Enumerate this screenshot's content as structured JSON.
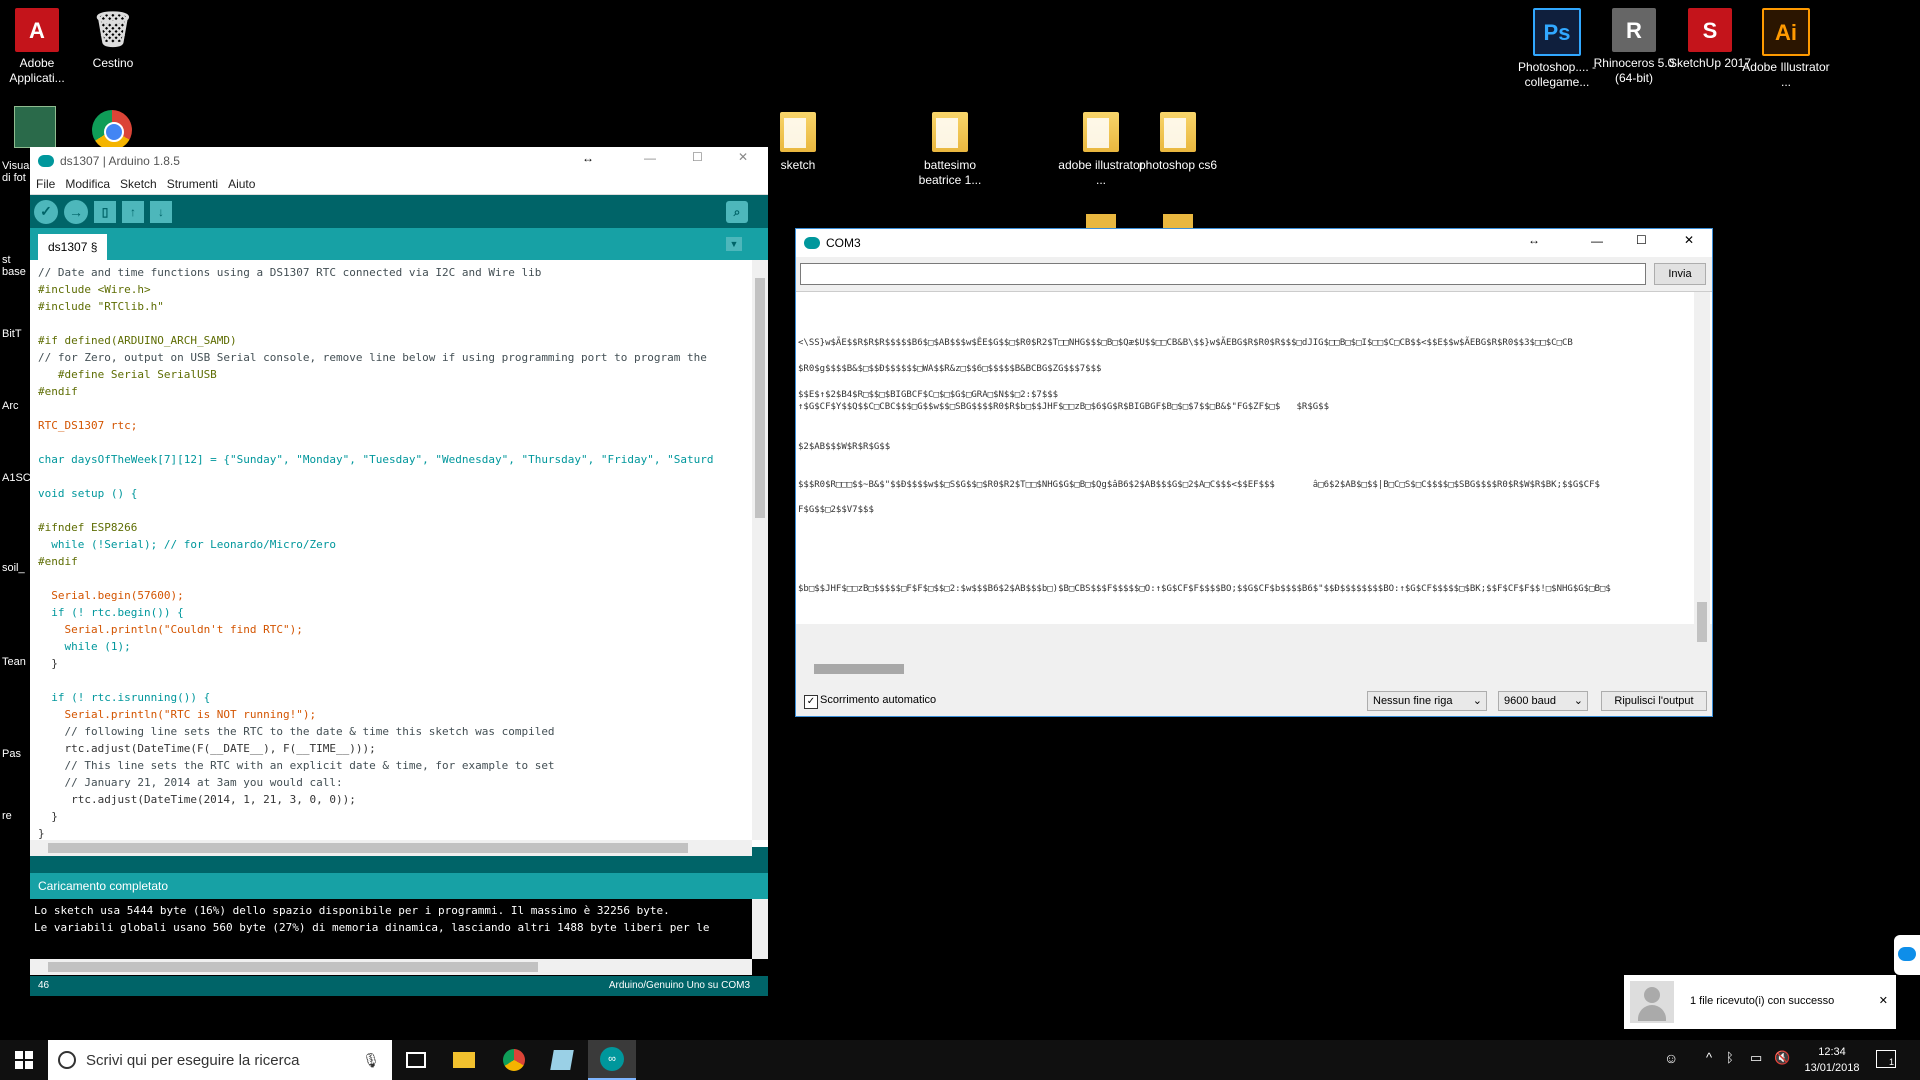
{
  "desktop": {
    "left_icons": [
      {
        "label": "Adobe Applicati...",
        "glyph": "A",
        "bg": "#c4141b"
      },
      {
        "label": "Cestino",
        "glyph": "🗑",
        "bg": "transparent"
      }
    ],
    "right_icons": [
      {
        "label": "Photoshop.... - collegame...",
        "glyph": "Ps",
        "bg": "#0f1f3d",
        "fg": "#31a8ff"
      },
      {
        "label": "Rhinoceros 5.0 (64-bit)",
        "glyph": "R",
        "bg": "#555",
        "fg": "#fff"
      },
      {
        "label": "SketchUp 2017",
        "glyph": "S",
        "bg": "#c4141b",
        "fg": "#fff"
      },
      {
        "label": "Adobe Illustrator ...",
        "glyph": "Ai",
        "bg": "#2b1500",
        "fg": "#ff9a00"
      }
    ],
    "folders": [
      {
        "label": "sketch"
      },
      {
        "label": "battesimo beatrice 1..."
      },
      {
        "label": "adobe illustrator ..."
      },
      {
        "label": "photoshop cs6"
      }
    ],
    "strip_labels": [
      "Visua di fot",
      "st base",
      "BitT",
      "Arc",
      "A1SC",
      "soil_",
      "Tean",
      "Pas",
      "re"
    ]
  },
  "arduino": {
    "title": "ds1307 | Arduino 1.8.5",
    "menu": [
      "File",
      "Modifica",
      "Sketch",
      "Strumenti",
      "Aiuto"
    ],
    "tab": "ds1307 §",
    "code": [
      "// Date and time functions using a DS1307 RTC connected via I2C and Wire lib",
      "#include <Wire.h>",
      "#include \"RTClib.h\"",
      "",
      "#if defined(ARDUINO_ARCH_SAMD)",
      "// for Zero, output on USB Serial console, remove line below if using programming port to program the",
      "   #define Serial SerialUSB",
      "#endif",
      "",
      "RTC_DS1307 rtc;",
      "",
      "char daysOfTheWeek[7][12] = {\"Sunday\", \"Monday\", \"Tuesday\", \"Wednesday\", \"Thursday\", \"Friday\", \"Saturd",
      "",
      "void setup () {",
      "",
      "#ifndef ESP8266",
      "  while (!Serial); // for Leonardo/Micro/Zero",
      "#endif",
      "",
      "  Serial.begin(57600);",
      "  if (! rtc.begin()) {",
      "    Serial.println(\"Couldn't find RTC\");",
      "    while (1);",
      "  }",
      "",
      "  if (! rtc.isrunning()) {",
      "    Serial.println(\"RTC is NOT running!\");",
      "    // following line sets the RTC to the date & time this sketch was compiled",
      "    rtc.adjust(DateTime(F(__DATE__), F(__TIME__)));",
      "    // This line sets the RTC with an explicit date & time, for example to set",
      "    // January 21, 2014 at 3am you would call:",
      "     rtc.adjust(DateTime(2014, 1, 21, 3, 0, 0));",
      "  }",
      "}"
    ],
    "status": "Caricamento completato",
    "console": [
      "Lo sketch usa 5444 byte (16%) dello spazio disponibile per i programmi. Il massimo è 32256 byte.",
      "Le variabili globali usano 560 byte (27%) di memoria dinamica, lasciando altri 1488 byte liberi per le"
    ],
    "line_number": "46",
    "board": "Arduino/Genuino Uno su COM3"
  },
  "com": {
    "title": "COM3",
    "input_value": "",
    "send_label": "Invia",
    "output": [
      "<\\SS}w$ÃE$$R$R$R$$$$$B6$□$AB$$$w$ÊE$G$$□$R0$R2$T□□NHG$$$□B□$Qæ$U$$□□CB&B\\$$}w$ÃEBG$R$R0$R$$$□dJIG$□□B□$□I$□□$C□CB$$<$$E$$w$ÃEBG$R$R0$$3$□□$C□CB",
      "$R0$g$$$$B&$□$$Ð$$$$$$□WA$$R&z□$$6□$$$$$B&BCBG$ZG$$$7$$$",
      "$$E$↑$2$B4$R□$$□$BIGBCF$C□$□$G$□GRA□$N$$□2:$7$$$",
      "↑$G$CF$Y$$Q$$C□CBC$$$□G$$w$$□SBG$$$$R0$R$b□$$JHF$□□zB□$6$G$R$BIGBGF$B□$□$7$$□B&$\"FG$ZF$□$   $R$G$$",
      "$2$AB$$$W$R$R$G$$",
      "$$$R0$R□□□$$~B&$\"$$Ð$$$$w$$□S$G$$□$R0$R2$T□□$NHG$G$□B□$Qg$âB6$2$AB$$$G$□2$A□C$$$<$$EF$$$       â□6$2$AB$□$$|B□C□S$□C$$$$□$SBG$$$$R0$R$W$R$BK;$$G$CF$",
      "F$G$$□2$$V7$$$",
      "$b□$$JHF$□□zB□$$$$$□F$F$□$$□2:$w$$$B6$2$AB$$$b□)$B□CBS$$$F$$$$$□O:↑$G$CF$F$$$$BO;$$G$CF$b$$$$B6$\"$$Ð$$$$$$$$BO:↑$G$CF$$$$$□$BK;$$F$CF$F$$!□$NHG$G$□B□$"
    ],
    "autoscroll_label": "Scorrimento automatico",
    "autoscroll_checked": true,
    "line_ending": "Nessun fine riga",
    "baud": "9600 baud",
    "clear_label": "Ripulisci l'output"
  },
  "notification": {
    "text": "1 file ricevuto(i) con successo"
  },
  "taskbar": {
    "search_placeholder": "Scrivi qui per eseguire la ricerca",
    "time": "12:34",
    "date": "13/01/2018",
    "action_center_count": "1"
  },
  "colors": {
    "arduino_dark": "#006468",
    "arduino_mid": "#17a1a5",
    "arduino_btn": "#4db7bb"
  }
}
